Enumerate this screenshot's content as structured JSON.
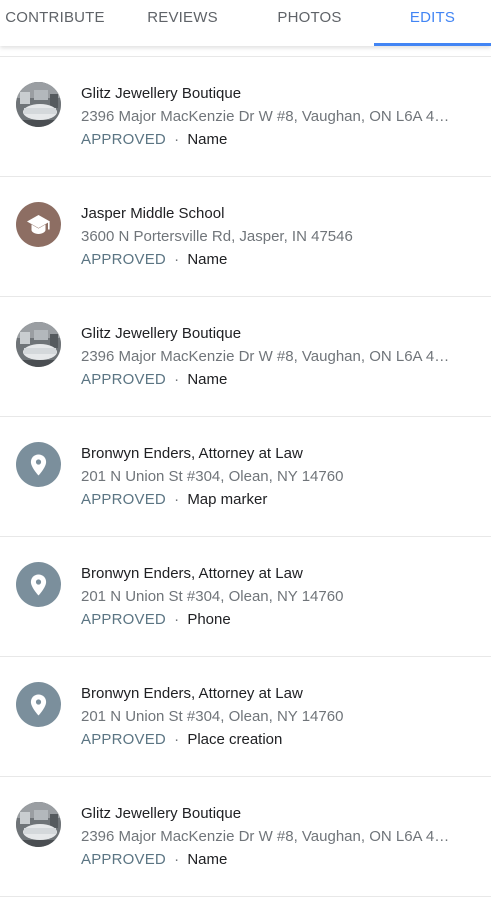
{
  "tabs": [
    {
      "label": "CONTRIBUTE",
      "active": false
    },
    {
      "label": "REVIEWS",
      "active": false
    },
    {
      "label": "PHOTOS",
      "active": false
    },
    {
      "label": "EDITS",
      "active": true
    }
  ],
  "separator": "·",
  "edits": [
    {
      "title": "Glitz Jewellery Boutique",
      "address": "2396 Major MacKenzie Dr W #8, Vaughan, ON L6A 4…",
      "status": "APPROVED",
      "edit_type": "Name",
      "icon": "store-photo"
    },
    {
      "title": "Jasper Middle School",
      "address": "3600 N Portersville Rd, Jasper, IN 47546",
      "status": "APPROVED",
      "edit_type": "Name",
      "icon": "school-icon"
    },
    {
      "title": "Glitz Jewellery Boutique",
      "address": "2396 Major MacKenzie Dr W #8, Vaughan, ON L6A 4…",
      "status": "APPROVED",
      "edit_type": "Name",
      "icon": "store-photo"
    },
    {
      "title": "Bronwyn Enders, Attorney at Law",
      "address": "201 N Union St #304, Olean, NY 14760",
      "status": "APPROVED",
      "edit_type": "Map marker",
      "icon": "place-pin-icon"
    },
    {
      "title": "Bronwyn Enders, Attorney at Law",
      "address": "201 N Union St #304, Olean, NY 14760",
      "status": "APPROVED",
      "edit_type": "Phone",
      "icon": "place-pin-icon"
    },
    {
      "title": "Bronwyn Enders, Attorney at Law",
      "address": "201 N Union St #304, Olean, NY 14760",
      "status": "APPROVED",
      "edit_type": "Place creation",
      "icon": "place-pin-icon"
    },
    {
      "title": "Glitz Jewellery Boutique",
      "address": "2396 Major MacKenzie Dr W #8, Vaughan, ON L6A 4…",
      "status": "APPROVED",
      "edit_type": "Name",
      "icon": "store-photo"
    }
  ],
  "colors": {
    "accent": "#4285f4",
    "status": "#5b7583",
    "pin_avatar": "#7b8f9c",
    "school_avatar": "#8d6e63"
  }
}
